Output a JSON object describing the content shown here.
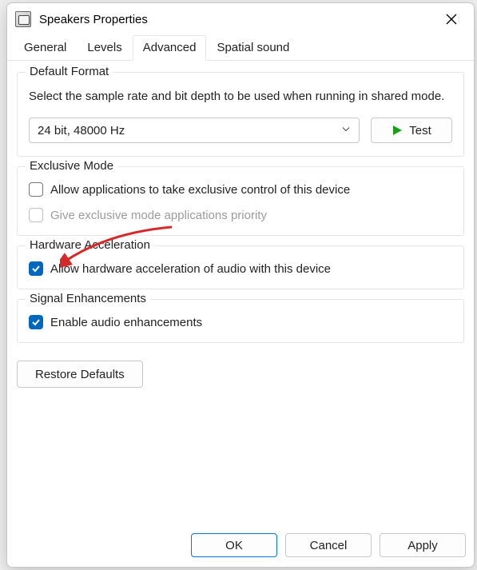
{
  "window": {
    "title": "Speakers Properties"
  },
  "tabs": [
    {
      "label": "General"
    },
    {
      "label": "Levels"
    },
    {
      "label": "Advanced"
    },
    {
      "label": "Spatial sound"
    }
  ],
  "defaultFormat": {
    "legend": "Default Format",
    "description": "Select the sample rate and bit depth to be used when running in shared mode.",
    "selected": "24 bit, 48000 Hz",
    "testLabel": "Test"
  },
  "exclusiveMode": {
    "legend": "Exclusive Mode",
    "allowExclusive": "Allow applications to take exclusive control of this device",
    "priority": "Give exclusive mode applications priority"
  },
  "hardwareAccel": {
    "legend": "Hardware Acceleration",
    "label": "Allow hardware acceleration of audio with this device"
  },
  "signalEnhancements": {
    "legend": "Signal Enhancements",
    "label": "Enable audio enhancements"
  },
  "buttons": {
    "restoreDefaults": "Restore Defaults",
    "ok": "OK",
    "cancel": "Cancel",
    "apply": "Apply"
  }
}
